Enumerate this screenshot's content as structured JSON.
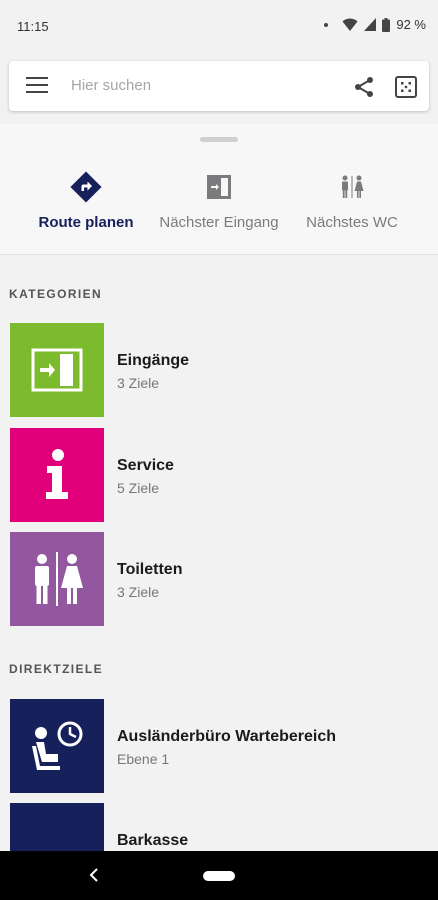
{
  "status_bar": {
    "time": "11:15",
    "battery": "92 %"
  },
  "search": {
    "placeholder": "Hier suchen"
  },
  "quick_actions": [
    {
      "label": "Route planen",
      "icon": "route-diamond-icon"
    },
    {
      "label": "Nächster Eingang",
      "icon": "entrance-door-icon"
    },
    {
      "label": "Nächstes WC",
      "icon": "toilet-people-icon"
    }
  ],
  "categories": {
    "title": "KATEGORIEN",
    "items": [
      {
        "name": "Eingänge",
        "count": "3 Ziele",
        "color": "#7bbb2d",
        "icon": "entrance-door-icon"
      },
      {
        "name": "Service",
        "count": "5 Ziele",
        "color": "#e2007a",
        "icon": "info-icon"
      },
      {
        "name": "Toiletten",
        "count": "3 Ziele",
        "color": "#93579f",
        "icon": "toilet-people-icon"
      }
    ]
  },
  "direct_targets": {
    "title": "DIREKTZIELE",
    "items": [
      {
        "name": "Ausländerbüro Wartebereich",
        "level": "Ebene 1",
        "color": "#16215c",
        "icon": "waiting-area-icon"
      },
      {
        "name": "Barkasse",
        "level": "",
        "color": "#16215c",
        "icon": "cash-desk-icon"
      }
    ]
  },
  "colors": {
    "brand": "#16215c",
    "background": "#f2f2f3"
  }
}
